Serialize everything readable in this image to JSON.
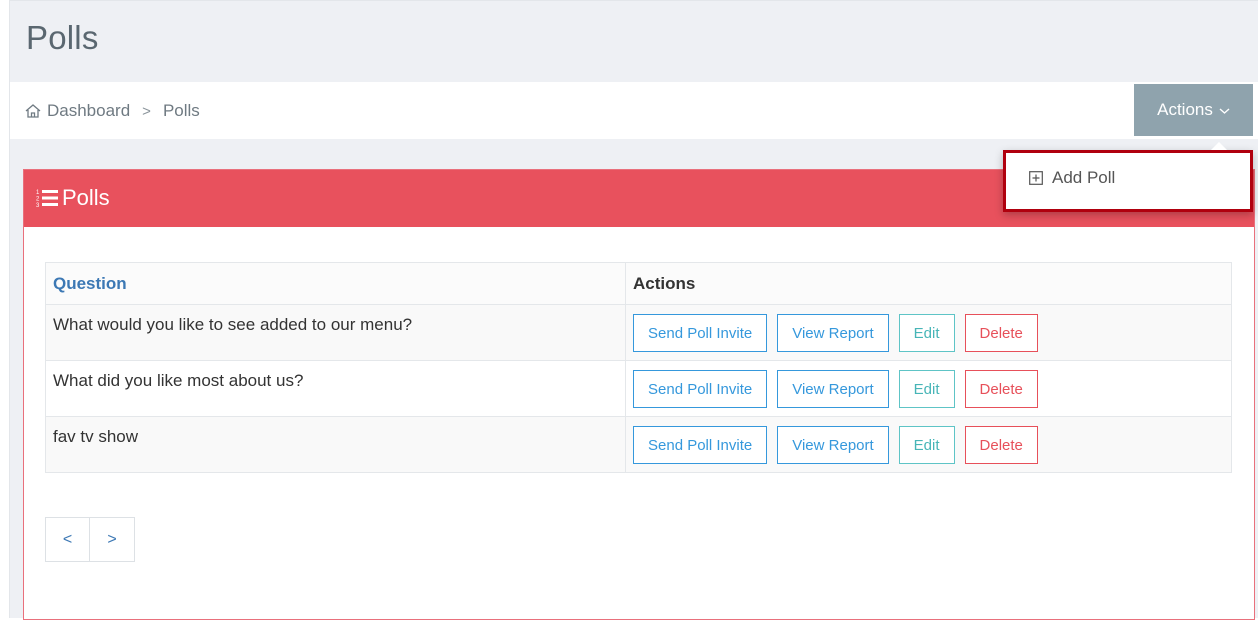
{
  "page": {
    "title": "Polls"
  },
  "breadcrumb": {
    "home_label": "Dashboard",
    "separator": ">",
    "current": "Polls"
  },
  "actions_menu": {
    "label": "Actions",
    "chevron": "v",
    "items": [
      {
        "label": "Add Poll",
        "icon": "plus-square-icon"
      }
    ]
  },
  "portlet": {
    "title": "Polls",
    "icon": "list-ol-icon",
    "header_color": "#e8515d"
  },
  "table": {
    "headers": {
      "question": "Question",
      "actions": "Actions"
    },
    "rows": [
      {
        "question": "What would you like to see added to our menu?"
      },
      {
        "question": "What did you like most about us?"
      },
      {
        "question": "fav tv show"
      }
    ],
    "row_buttons": {
      "invite": "Send Poll Invite",
      "report": "View Report",
      "edit": "Edit",
      "delete": "Delete"
    }
  },
  "pagination": {
    "prev": "<",
    "next": ">"
  },
  "colors": {
    "accent_blue": "#3598dc",
    "teal": "#5ec4c6",
    "red": "#e7505a",
    "highlight": "#b0000e",
    "actions_button": "#8fa3ad"
  }
}
